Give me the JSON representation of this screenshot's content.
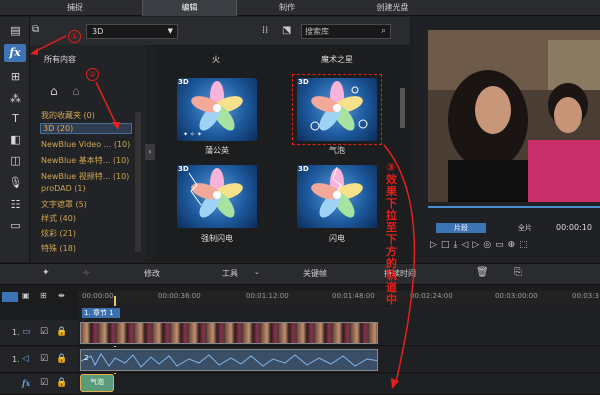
{
  "top_tabs": {
    "capture": "捕捉",
    "edit": "编辑",
    "produce": "制作",
    "create_disc": "创建光盘"
  },
  "toolbar": {
    "room_dropdown": "3D",
    "search_placeholder": "搜索库"
  },
  "category_list": {
    "all_content": "所有内容",
    "items": [
      "我的收藏夹 (0)",
      "3D (20)",
      "NewBlue Video ... (10)",
      "NewBlue 基本特... (10)",
      "NewBlue 视频特... (10)",
      "proDAD (1)",
      "文字遮罩 (5)",
      "样式 (40)",
      "炫彩 (21)",
      "特殊 (18)"
    ],
    "selected_index": 1
  },
  "effect_grid": {
    "top_labels": [
      "火",
      "魔术之星"
    ],
    "items": [
      {
        "tag": "3D",
        "label": "蒲公英"
      },
      {
        "tag": "3D",
        "label": "气泡"
      },
      {
        "tag": "3D",
        "label": "强制闪电"
      },
      {
        "tag": "3D",
        "label": "闪电"
      }
    ]
  },
  "preview": {
    "tab_clip": "片段",
    "tab_movie": "全片",
    "timecode": "00:00:10"
  },
  "edit_toolbar": {
    "modify": "修改",
    "tools": "工具",
    "keyframe": "关键帧",
    "duration": "持续时间"
  },
  "timeline": {
    "ruler_ticks": [
      "00:00:00",
      "00:00:36:00",
      "00:01:12:00",
      "00:01:48:00",
      "00:02:24:00",
      "00:03:00:00",
      "00:03:3"
    ],
    "chapter_label": "1. 章节 1",
    "track_labels": [
      "1.",
      "1.",
      "fx"
    ],
    "audio_marker": "2",
    "fx_clip_label": "气泡"
  },
  "annotations": {
    "step1": "①",
    "step2": "②",
    "step3_text": "③效果下拉至下方的轨道中"
  },
  "colors": {
    "accent": "#3c74b5",
    "annotation_red": "#e3201b",
    "category_gold": "#d0a550"
  }
}
